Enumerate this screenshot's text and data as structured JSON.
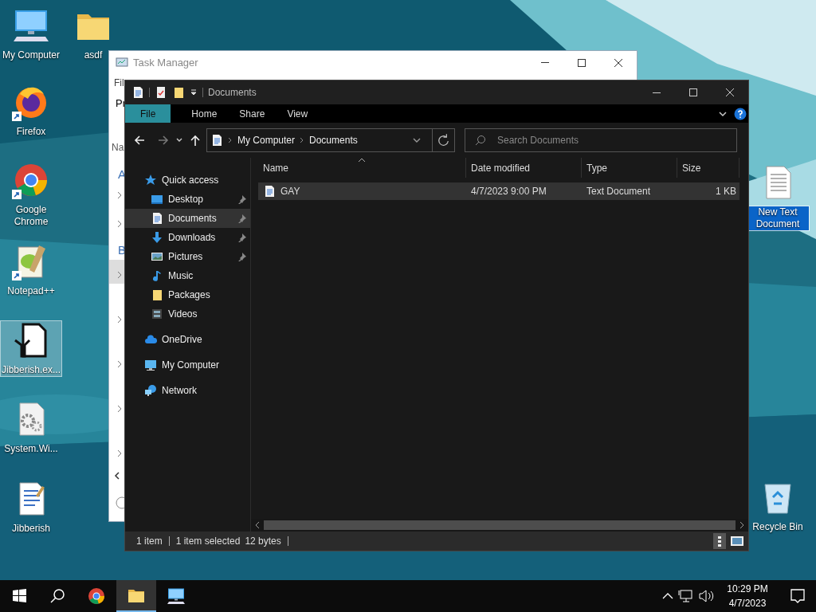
{
  "desktop": {
    "icons": [
      {
        "label": "My Computer",
        "kind": "monitor",
        "shortcut": false,
        "selected": false
      },
      {
        "label": "asdf",
        "kind": "folder",
        "shortcut": false,
        "selected": false
      },
      {
        "label": "Firefox",
        "kind": "flame",
        "shortcut": true,
        "selected": false
      },
      {
        "label": "Google Chrome",
        "kind": "wheel",
        "shortcut": true,
        "selected": false
      },
      {
        "label": "Notepad++",
        "kind": "notepad",
        "shortcut": true,
        "selected": false
      },
      {
        "label": "Jibberish.ex...",
        "kind": "tool",
        "shortcut": false,
        "selected": true
      },
      {
        "label": "System.Wi...",
        "kind": "gear",
        "shortcut": false,
        "selected": false
      },
      {
        "label": "Jibberish",
        "kind": "page",
        "shortcut": false,
        "selected": false
      },
      {
        "label": "New Text Document",
        "kind": "textfile",
        "shortcut": false,
        "selected": true
      },
      {
        "label": "Recycle Bin",
        "kind": "bin",
        "shortcut": false,
        "selected": false
      }
    ]
  },
  "task_manager": {
    "title": "Task Manager",
    "menu": "Fil",
    "tab": "Pr",
    "column": "Na",
    "groups": [
      "A",
      "B"
    ]
  },
  "explorer": {
    "title": "Documents",
    "ribbon_tabs": [
      {
        "label": "File",
        "selected": true
      },
      {
        "label": "Home",
        "selected": false
      },
      {
        "label": "Share",
        "selected": false
      },
      {
        "label": "View",
        "selected": false
      }
    ],
    "address": [
      "My Computer",
      "Documents"
    ],
    "search": {
      "placeholder": "Search Documents"
    },
    "nav": [
      {
        "label": "Quick access",
        "kind": "star",
        "selected": false,
        "children": [
          {
            "label": "Desktop",
            "kind": "desktop",
            "pinned": true,
            "selected": false
          },
          {
            "label": "Documents",
            "kind": "document",
            "pinned": true,
            "selected": true
          },
          {
            "label": "Downloads",
            "kind": "download",
            "pinned": true,
            "selected": false
          },
          {
            "label": "Pictures",
            "kind": "picture",
            "pinned": true,
            "selected": false
          },
          {
            "label": "Music",
            "kind": "music",
            "pinned": false,
            "selected": false
          },
          {
            "label": "Packages",
            "kind": "folder",
            "pinned": false,
            "selected": false
          },
          {
            "label": "Videos",
            "kind": "video",
            "pinned": false,
            "selected": false
          }
        ]
      },
      {
        "label": "OneDrive",
        "kind": "cloud",
        "selected": false
      },
      {
        "label": "My Computer",
        "kind": "monitor",
        "selected": false
      },
      {
        "label": "Network",
        "kind": "network",
        "selected": false
      }
    ],
    "columns": [
      "Name",
      "Date modified",
      "Type",
      "Size"
    ],
    "rows": [
      {
        "name": "GAY",
        "date_modified": "4/7/2023 9:00 PM",
        "type": "Text Document",
        "size": "1 KB",
        "selected": true
      }
    ],
    "status": [
      "1 item",
      "1 item selected",
      "12 bytes"
    ]
  },
  "taskbar": {
    "apps": [
      {
        "kind": "wheel",
        "active": false
      },
      {
        "kind": "folder",
        "active": true
      },
      {
        "kind": "monitor",
        "active": false
      }
    ],
    "time": "10:29 PM",
    "date": "4/7/2023"
  }
}
